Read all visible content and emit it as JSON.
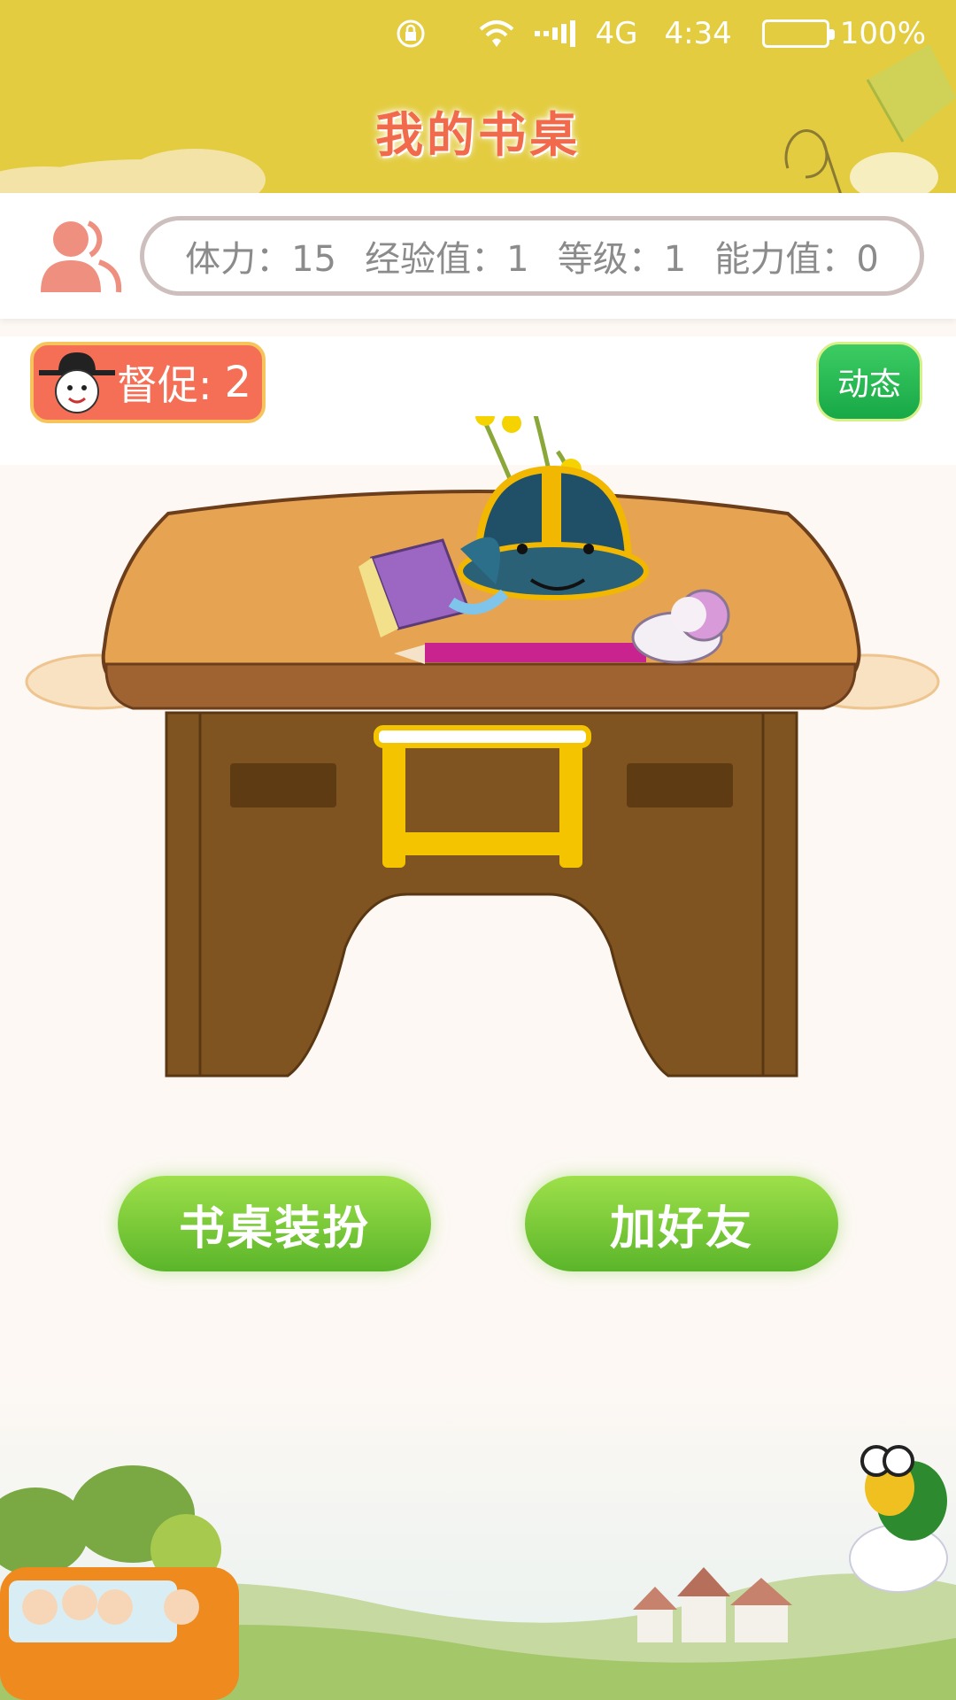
{
  "status_bar": {
    "network": "4G",
    "time": "4:34",
    "battery": "100%",
    "icons": [
      "rotation-lock-icon",
      "wifi-icon",
      "signal-icon",
      "battery-icon"
    ]
  },
  "header": {
    "title": "我的书桌"
  },
  "stats": {
    "stamina": "体力：15",
    "experience": "经验值：1",
    "level": "等级：1",
    "ability": "能力值：0"
  },
  "controls": {
    "urge_label": "督促:",
    "urge_count": "2",
    "dynamic_label": "动态"
  },
  "actions": {
    "decorate_label": "书桌装扮",
    "add_friend_label": "加好友"
  },
  "colors": {
    "header_bg": "#e3cc3f",
    "title": "#f26a4c",
    "urge_bg": "#f46f55",
    "dynamic_bg": "#17a847",
    "action_bg": "#7ac93a",
    "stat_text": "#8b8b8b"
  }
}
